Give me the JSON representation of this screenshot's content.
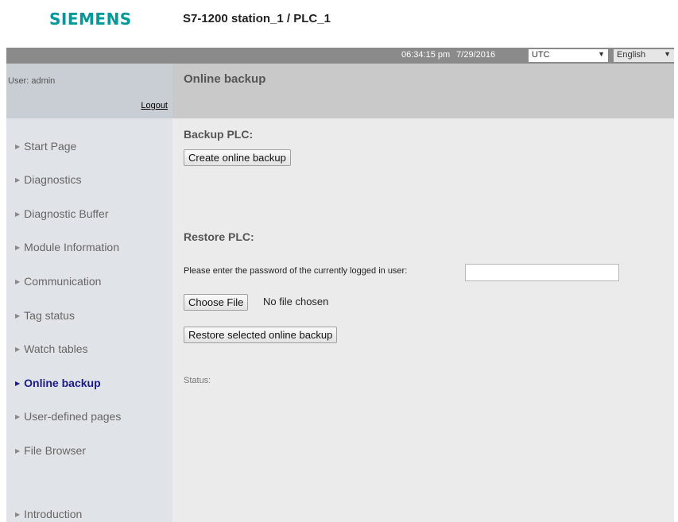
{
  "header": {
    "brand": "SIEMENS",
    "station": "S7-1200 station_1 / PLC_1"
  },
  "statusbar": {
    "time": "06:34:15 pm",
    "date": "7/29/2016",
    "timezone": "UTC",
    "language": "English"
  },
  "user": {
    "label": "User: admin",
    "logout": "Logout"
  },
  "nav": {
    "items": [
      {
        "label": "Start Page"
      },
      {
        "label": "Diagnostics"
      },
      {
        "label": "Diagnostic Buffer"
      },
      {
        "label": "Module Information"
      },
      {
        "label": "Communication"
      },
      {
        "label": "Tag status"
      },
      {
        "label": "Watch tables"
      },
      {
        "label": "Online backup",
        "active": true
      },
      {
        "label": "User-defined pages"
      },
      {
        "label": "File Browser"
      },
      {
        "label": "Introduction"
      }
    ]
  },
  "main": {
    "title": "Online backup",
    "backup": {
      "heading": "Backup PLC:",
      "button": "Create online backup"
    },
    "restore": {
      "heading": "Restore PLC:",
      "password_label": "Please enter the password of the currently logged in user:",
      "password_value": "",
      "choose_file_button": "Choose File",
      "file_status": "No file chosen",
      "restore_button": "Restore selected online backup"
    },
    "status_label": "Status:"
  },
  "colors": {
    "brand": "#009999",
    "active_nav": "#1a1a8c",
    "statusbar": "#8a8a8a"
  }
}
